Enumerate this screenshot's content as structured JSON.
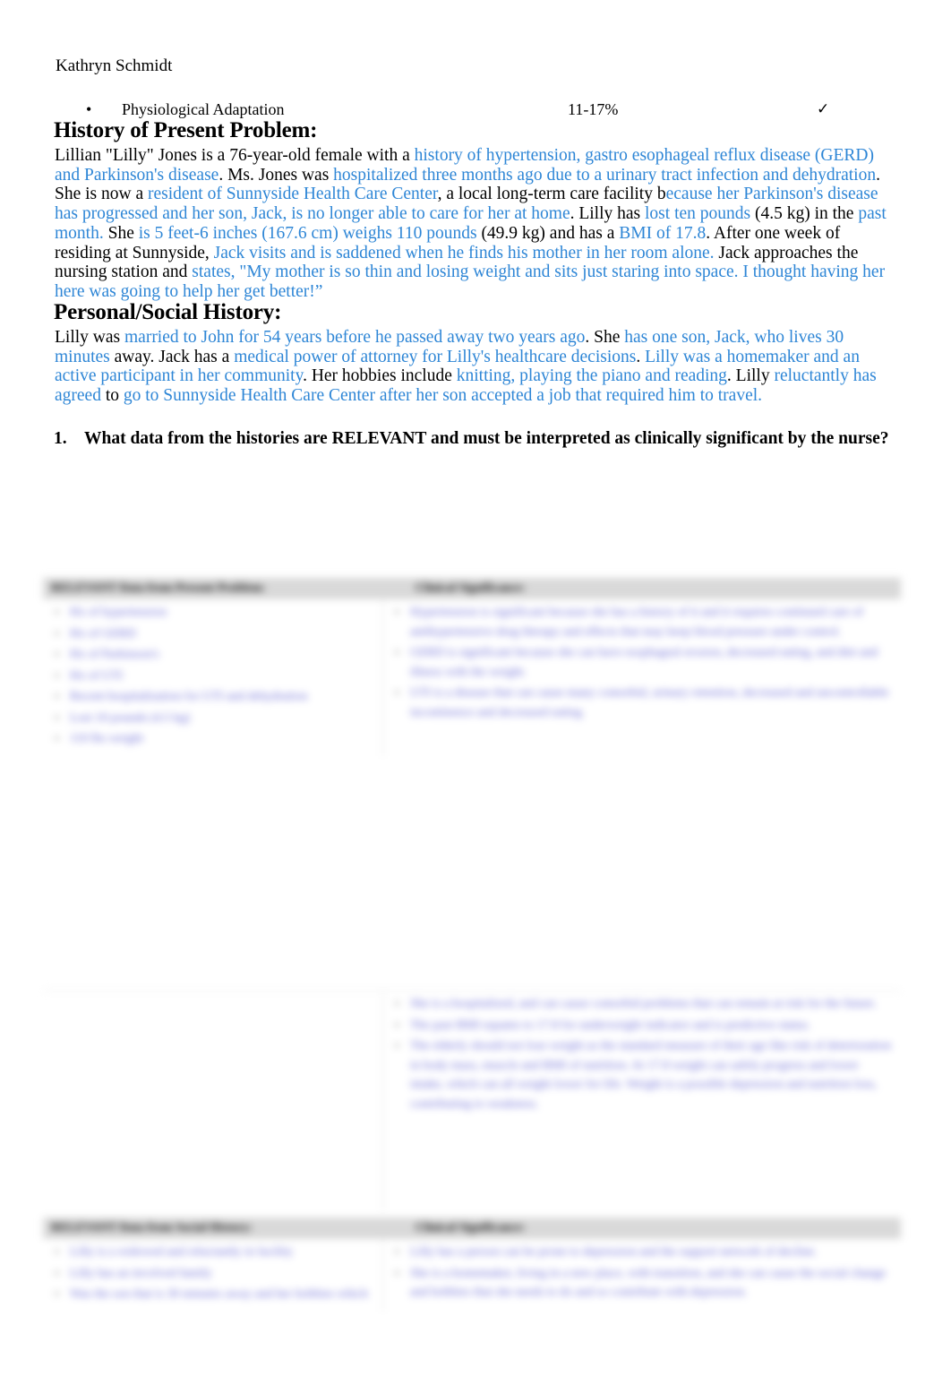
{
  "document": {
    "author": "Kathryn Schmidt",
    "bullet_row": {
      "bullet_glyph": "•",
      "label": "Physiological Adaptation",
      "percent": "11-17%",
      "check": "✓"
    },
    "accent_color": "#2E86D6",
    "table_text_color": "#6b6bd6",
    "header_bg": "#d9d9d9"
  },
  "hpi": {
    "heading": "History of Present Problem:",
    "segments": [
      {
        "text": "Lillian \"Lilly\" Jones is a 76-year-old female with a ",
        "highlight": false
      },
      {
        "text": "history of hypertension, gastro esophageal reflux disease (GERD) and Parkinson's disease",
        "highlight": true
      },
      {
        "text": ". Ms. Jones was ",
        "highlight": false
      },
      {
        "text": "hospitalized three months ago due to a urinary tract infection and dehydration",
        "highlight": true
      },
      {
        "text": ". She is now a ",
        "highlight": false
      },
      {
        "text": "resident of Sunnyside Health Care Center",
        "highlight": true
      },
      {
        "text": ", a local long-term care facility b",
        "highlight": false
      },
      {
        "text": "ecause her Parkinson's disease has progressed and her son, Jack, is no longer able to care for her at home",
        "highlight": true
      },
      {
        "text": ". Lilly has ",
        "highlight": false
      },
      {
        "text": "lost ten pounds",
        "highlight": true
      },
      {
        "text": " (4.5 kg) in the ",
        "highlight": false
      },
      {
        "text": "past month.",
        "highlight": true
      },
      {
        "text": " She ",
        "highlight": false
      },
      {
        "text": "is 5 feet-6 inches (167.6 cm) weighs 110 pounds",
        "highlight": true
      },
      {
        "text": " (49.9 kg) and has a ",
        "highlight": false
      },
      {
        "text": "BMI of 17.8",
        "highlight": true
      },
      {
        "text": ". After one week of residing at Sunnyside, ",
        "highlight": false
      },
      {
        "text": "Jack visits and is saddened when he finds his mother in her room alone.",
        "highlight": true
      },
      {
        "text": " Jack approaches the nursing station and ",
        "highlight": false
      },
      {
        "text": "states, \"My mother is so thin and losing weight and sits just staring into space. I thought having her here was going to help her get better!”",
        "highlight": true
      }
    ]
  },
  "psh": {
    "heading": "Personal/Social History:",
    "segments": [
      {
        "text": "Lilly was ",
        "highlight": false
      },
      {
        "text": "married to John for 54 years before he passed away two years ago",
        "highlight": true
      },
      {
        "text": ". She ",
        "highlight": false
      },
      {
        "text": "has one son, Jack, who lives 30 minutes",
        "highlight": true
      },
      {
        "text": " away. Jack has a ",
        "highlight": false
      },
      {
        "text": "medical power of attorney for Lilly's healthcare decisions",
        "highlight": true
      },
      {
        "text": ". ",
        "highlight": false
      },
      {
        "text": "Lilly was a homemaker and an active participant in her community",
        "highlight": true
      },
      {
        "text": ". Her hobbies include ",
        "highlight": false
      },
      {
        "text": "knitting, playing the piano and reading",
        "highlight": true
      },
      {
        "text": ". Lilly ",
        "highlight": false
      },
      {
        "text": "reluctantly has agreed",
        "highlight": true
      },
      {
        "text": " to ",
        "highlight": false
      },
      {
        "text": "go to Sunnyside Health Care Center after her son accepted a job that required him to travel.",
        "highlight": true
      }
    ]
  },
  "question": {
    "number": "1.",
    "text": "What data from the histories are RELEVANT and must be interpreted as clinically significant by the nurse?"
  },
  "table_hpi": {
    "headers": {
      "left": "RELEVANT Data from Present Problem:",
      "right": "Clinical Significance:"
    },
    "left_items": [
      "Hx of hypertension",
      "Hx of GERD",
      "Hx of Parkinson's",
      "Hx of UTI",
      "Recent hospitalization for UTI and dehydration",
      "Lost 10 pounds (4.5 kg)",
      "110 lbs weight"
    ],
    "right_items": [
      "Hypertension is significant because she has a history of it and it requires continued care of antihypertensive drug therapy and effects that may keep blood pressure under control.",
      "GERD is significant because she can have esophageal erosion, decreased eating, and diet and illness with the weight.",
      "UTI is a disease that can cause many comorbid, urinary retention, decreased and uncontrollable incontinence and decreased eating."
    ]
  },
  "table_hpi_cont": {
    "right_items": [
      "She is a hospitalized, and can cause comorbid problems that can remain at risk for the future.",
      "The past BMI equates to 17.8 for underweight indicator and is predictive status.",
      "The elderly should not lose weight as the standard measure of their age like risk of deterioration in body mass, muscle and BMI of nutrition. At 17.8 weight can safely progress and lower intake, which can all weight lower for life. Weight is a possible depression and nutrition loss, contributing to weakness."
    ]
  },
  "table_psh": {
    "headers": {
      "left": "RELEVANT Data from Social History:",
      "right": "Clinical Significance:"
    },
    "left_items": [
      "Lilly is a widowed and reluctantly in facility",
      "Lilly has an involved family",
      "Was the son that is 30 minutes away and her hobbies which"
    ],
    "right_items": [
      "Lilly has a person can be prone to depression and the support network of decline.",
      "She is a homemaker, living in a new place, with transition, and she can cause the social change and hobbies that she needs to do and so contribute with depression."
    ]
  }
}
